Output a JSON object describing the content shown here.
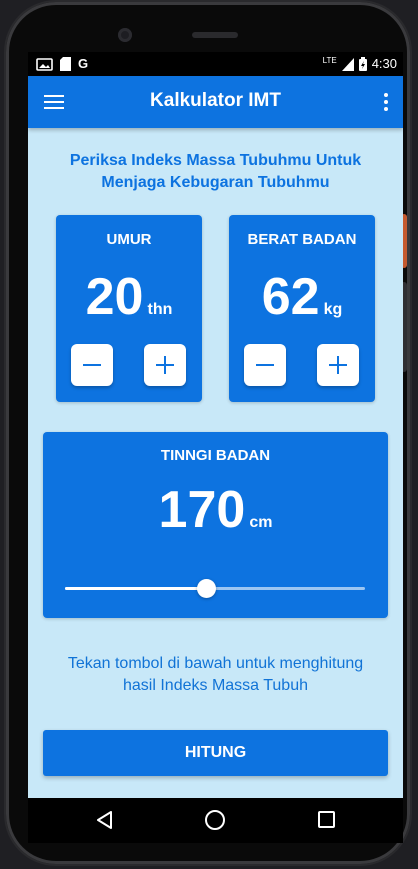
{
  "statusbar": {
    "carrier_glyph": "G",
    "network": "LTE",
    "time": "4:30"
  },
  "toolbar": {
    "title": "Kalkulator IMT"
  },
  "intro_text": "Periksa Indeks Massa Tubuhmu Untuk Menjaga Kebugaran Tubuhmu",
  "age_card": {
    "label": "UMUR",
    "value": "20",
    "unit": "thn"
  },
  "weight_card": {
    "label": "BERAT BADAN",
    "value": "62",
    "unit": "kg"
  },
  "height_card": {
    "label": "TINNGI BADAN",
    "value": "170",
    "unit": "cm",
    "slider_fraction": 0.47
  },
  "hint_text": "Tekan tombol di bawah untuk menghitung hasil Indeks Massa Tubuh",
  "action_button": {
    "label": "HITUNG"
  },
  "colors": {
    "primary": "#0d73e0",
    "background": "#c8e8f8"
  },
  "icons": {
    "menu": "hamburger-icon",
    "more": "more-vertical-icon",
    "minus": "minus-icon",
    "plus": "plus-icon",
    "back": "back-icon",
    "home": "home-icon",
    "recent": "recent-apps-icon"
  }
}
